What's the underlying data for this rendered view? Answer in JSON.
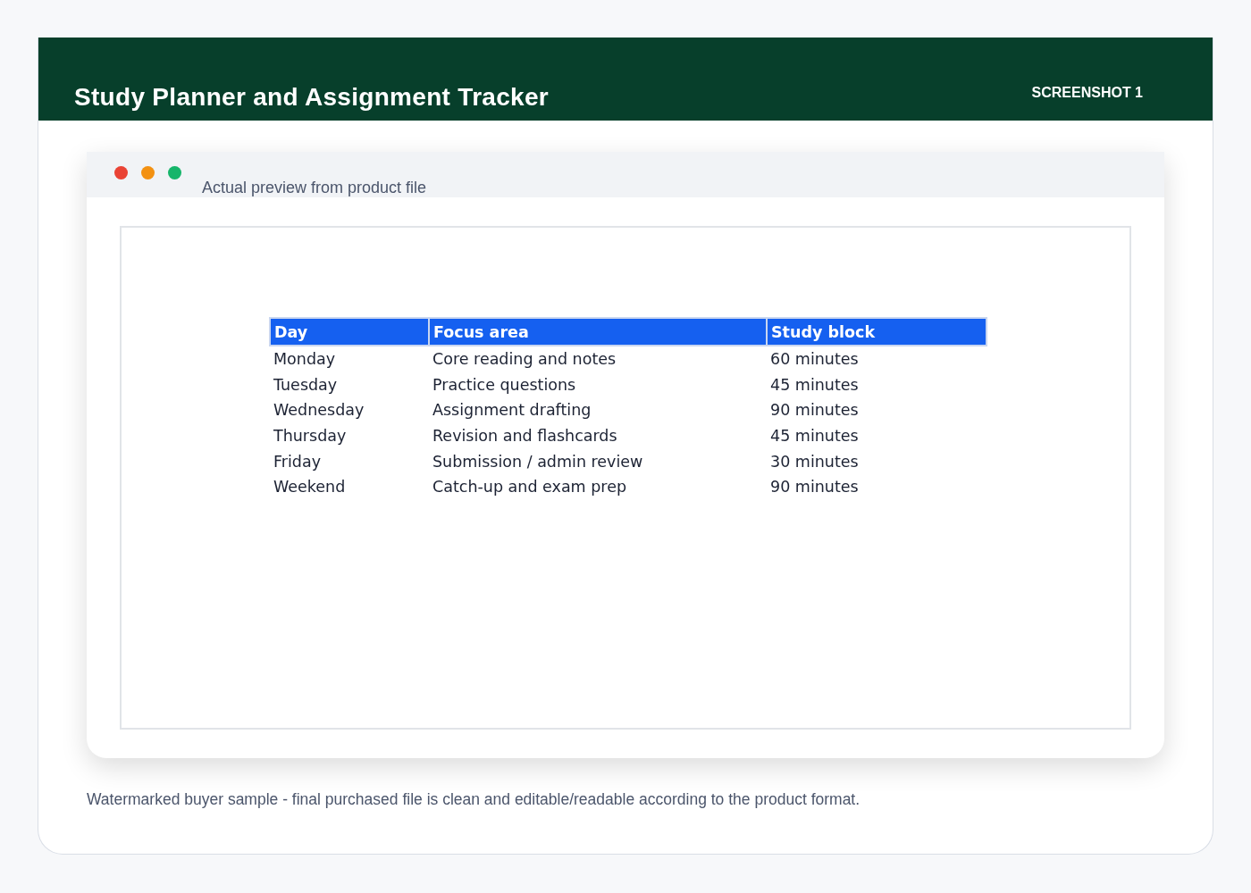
{
  "header": {
    "title": "Study Planner and Assignment Tracker",
    "badge": "SCREENSHOT 1"
  },
  "preview_window": {
    "caption": "Actual preview from product file"
  },
  "table": {
    "columns": [
      "Day",
      "Focus area",
      "Study block"
    ],
    "rows": [
      [
        "Monday",
        "Core reading and notes",
        "60 minutes"
      ],
      [
        "Tuesday",
        "Practice questions",
        "45 minutes"
      ],
      [
        "Wednesday",
        "Assignment drafting",
        "90 minutes"
      ],
      [
        "Thursday",
        "Revision and flashcards",
        "45 minutes"
      ],
      [
        "Friday",
        "Submission / admin review",
        "30 minutes"
      ],
      [
        "Weekend",
        "Catch-up and exam prep",
        "90 minutes"
      ]
    ]
  },
  "footer_note": "Watermarked buyer sample - final purchased file is clean and editable/readable according to the product format."
}
